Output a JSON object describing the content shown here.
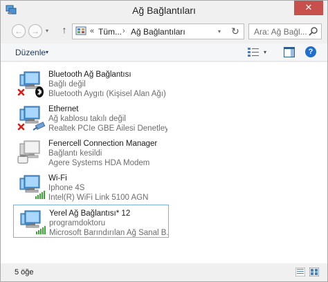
{
  "window": {
    "title": "Ağ Bağlantıları",
    "close_glyph": "✕"
  },
  "nav": {
    "back_glyph": "←",
    "forward_glyph": "→",
    "up_glyph": "↑",
    "dropdown_glyph": "▾",
    "address": {
      "overflow": "«",
      "crumbs": [
        "Tüm...",
        "Ağ Bağlantıları"
      ],
      "separator": "›",
      "refresh_glyph": "↻"
    },
    "search_placeholder": "Ara: Ağ Bağl..."
  },
  "commandbar": {
    "organize_label": "Düzenle",
    "dropdown_glyph": "▾",
    "help_glyph": "?"
  },
  "connections": [
    {
      "name": "Bluetooth Ağ Bağlantısı",
      "status": "Bağlı değil",
      "device": "Bluetooth Aygıtı (Kişisel Alan Ağı)",
      "icon": "network-disconnected-bluetooth-icon"
    },
    {
      "name": "Ethernet",
      "status": "Ağ kablosu takılı değil",
      "device": "Realtek PCIe GBE Ailesi Denetleyici",
      "icon": "network-disconnected-ethernet-icon"
    },
    {
      "name": "Fenercell Connection Manager",
      "status": "Bağlantı kesildi",
      "device": "Agere Systems HDA Modem",
      "icon": "dialup-modem-icon"
    },
    {
      "name": "Wi-Fi",
      "status": "Iphone 4S",
      "device": "Intel(R) WiFi Link 5100 AGN",
      "icon": "wifi-connected-icon"
    },
    {
      "name": "Yerel Ağ Bağlantısı* 12",
      "status": "programdoktoru",
      "device": "Microsoft Barındırılan Ağ Sanal B...",
      "icon": "wifi-connected-icon",
      "selected": true
    }
  ],
  "statusbar": {
    "item_count": "5 öğe"
  },
  "colors": {
    "accent": "#1e6fd0",
    "close": "#c7504d",
    "selection_border": "#7ab0e8",
    "error_red": "#d0201a",
    "signal_green": "#38a832"
  }
}
